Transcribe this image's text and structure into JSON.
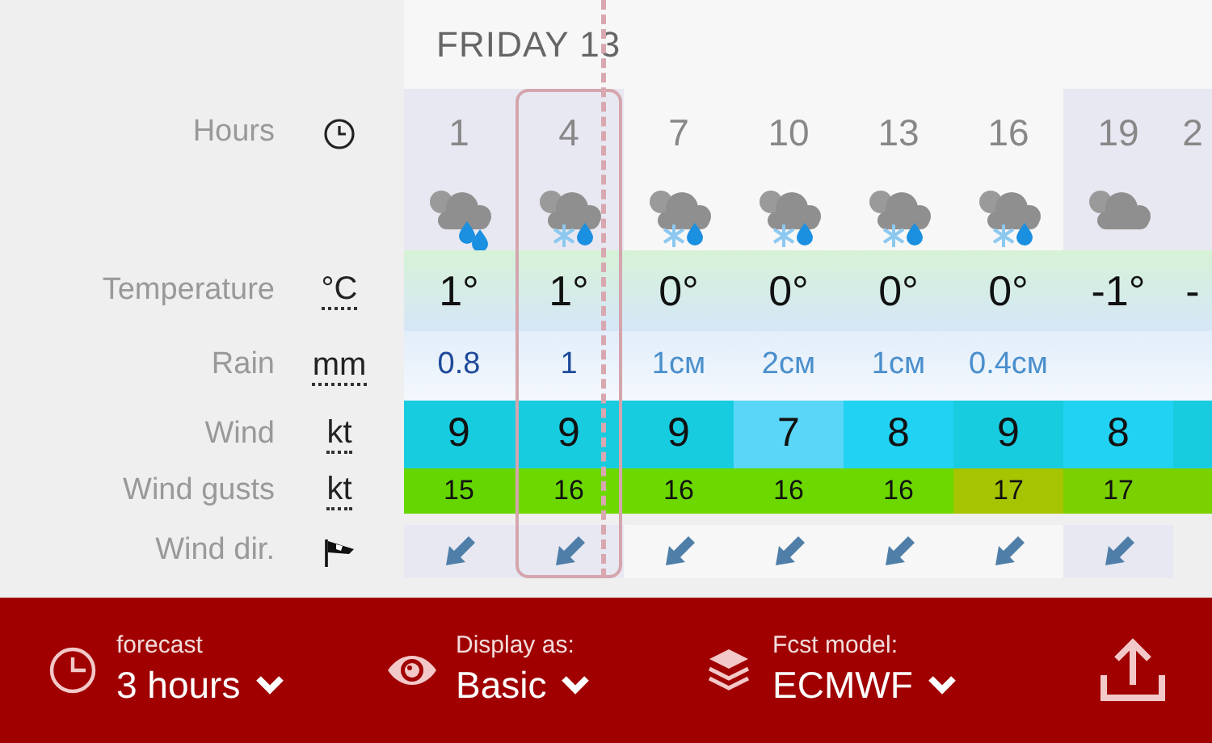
{
  "day_header": "FRIDAY 13",
  "row_labels": [
    {
      "kind": "hours",
      "label": "Hours"
    },
    {
      "kind": "icons"
    },
    {
      "kind": "temperature",
      "label": "Temperature",
      "unit": "°C"
    },
    {
      "kind": "rain",
      "label": "Rain",
      "unit": "mm"
    },
    {
      "kind": "wind",
      "label": "Wind",
      "unit": "kt"
    },
    {
      "kind": "gusts",
      "label": "Wind gusts",
      "unit": "kt"
    },
    {
      "kind": "direction",
      "label": "Wind dir."
    }
  ],
  "columns": [
    {
      "hour": "1",
      "night": true,
      "kind": "rain",
      "temp": "1°",
      "rain": {
        "value": "0.8",
        "color": "#1f4a9a"
      },
      "wind": {
        "value": "9",
        "color": "#18cce0"
      },
      "gust": {
        "value": "15",
        "color": "#66d600"
      },
      "selected": false
    },
    {
      "hour": "4",
      "night": true,
      "kind": "sleet",
      "temp": "1°",
      "rain": {
        "value": "1",
        "color": "#1f4a9a"
      },
      "wind": {
        "value": "9",
        "color": "#18cce0"
      },
      "gust": {
        "value": "16",
        "color": "#6cd800"
      },
      "selected": true
    },
    {
      "hour": "7",
      "night": false,
      "kind": "sleet",
      "temp": "0°",
      "rain": {
        "value": "1см",
        "color": "#4a8fcc"
      },
      "wind": {
        "value": "9",
        "color": "#18cce0"
      },
      "gust": {
        "value": "16",
        "color": "#6cd800"
      },
      "selected": false
    },
    {
      "hour": "10",
      "night": false,
      "kind": "sleet",
      "temp": "0°",
      "rain": {
        "value": "2см",
        "color": "#4a8fcc"
      },
      "wind": {
        "value": "7",
        "color": "#5ad6f8"
      },
      "gust": {
        "value": "16",
        "color": "#6cd800"
      },
      "selected": false
    },
    {
      "hour": "13",
      "night": false,
      "kind": "sleet",
      "temp": "0°",
      "rain": {
        "value": "1см",
        "color": "#4a8fcc"
      },
      "wind": {
        "value": "8",
        "color": "#22d2f2"
      },
      "gust": {
        "value": "16",
        "color": "#6cd800"
      },
      "selected": false
    },
    {
      "hour": "16",
      "night": false,
      "kind": "sleet",
      "temp": "0°",
      "rain": {
        "value": "0.4см",
        "color": "#4a8fcc"
      },
      "wind": {
        "value": "9",
        "color": "#18cce0"
      },
      "gust": {
        "value": "17",
        "color": "#a6c400"
      },
      "selected": false
    },
    {
      "hour": "19",
      "night": true,
      "kind": "cloud",
      "temp": "-1°",
      "wind": {
        "value": "8",
        "color": "#22d2f2"
      },
      "gust": {
        "value": "17",
        "color": "#7ad000"
      },
      "selected": false
    },
    {
      "hour": "2",
      "night": true,
      "partial": true,
      "temp": "-",
      "selected": false
    }
  ],
  "footer": [
    {
      "kind": "clock",
      "label": "forecast",
      "value": "3 hours"
    },
    {
      "kind": "eye",
      "label": "Display as:",
      "value": "Basic"
    },
    {
      "kind": "layers",
      "label": "Fcst model:",
      "value": "ECMWF"
    }
  ]
}
